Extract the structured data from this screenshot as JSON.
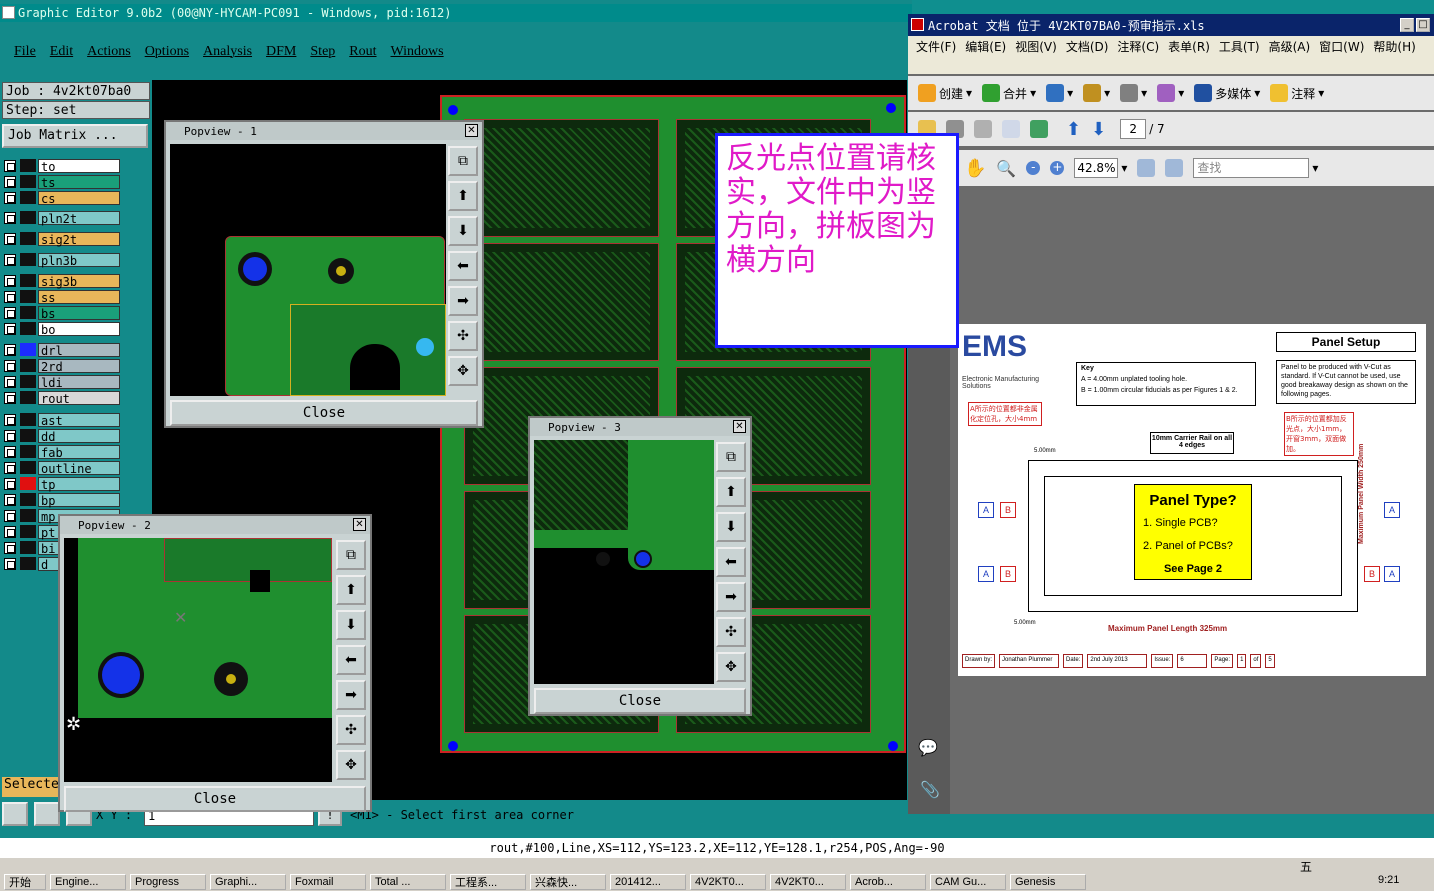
{
  "main": {
    "title": "Graphic Editor 9.0b2 (00@NY-HYCAM-PC091 - Windows, pid:1612)",
    "menu": [
      "File",
      "Edit",
      "Actions",
      "Options",
      "Analysis",
      "DFM",
      "Step",
      "Rout",
      "Windows"
    ],
    "job": "Job : 4v2kt07ba0",
    "step": "Step: set",
    "job_matrix": "Job Matrix ...",
    "layers": [
      {
        "name": "to",
        "color": "#ffffff",
        "swatch": "#111111"
      },
      {
        "name": "ts",
        "color": "#1aa07a",
        "swatch": "#111111"
      },
      {
        "name": "cs",
        "color": "#e8b65a",
        "swatch": "#111111"
      },
      {
        "name": "pln2t",
        "color": "#7fc8c8",
        "swatch": "#111111"
      },
      {
        "name": "sig2t",
        "color": "#e8b65a",
        "swatch": "#111111"
      },
      {
        "name": "pln3b",
        "color": "#7fc8c8",
        "swatch": "#111111"
      },
      {
        "name": "sig3b",
        "color": "#e8b65a",
        "swatch": "#111111"
      },
      {
        "name": "ss",
        "color": "#e8b65a",
        "swatch": "#111111"
      },
      {
        "name": "bs",
        "color": "#1aa07a",
        "swatch": "#111111"
      },
      {
        "name": "bo",
        "color": "#ffffff",
        "swatch": "#111111"
      },
      {
        "name": "drl",
        "color": "#a8b8c0",
        "swatch": "#1c2cff"
      },
      {
        "name": "2rd",
        "color": "#a8b8c0",
        "swatch": "#111111"
      },
      {
        "name": "ldi",
        "color": "#a8b8c0",
        "swatch": "#111111"
      },
      {
        "name": "rout",
        "color": "#d8d8d8",
        "swatch": "#111111"
      },
      {
        "name": "ast",
        "color": "#7fc8c8",
        "swatch": "#111111"
      },
      {
        "name": "dd",
        "color": "#7fc8c8",
        "swatch": "#111111"
      },
      {
        "name": "fab",
        "color": "#7fc8c8",
        "swatch": "#111111"
      },
      {
        "name": "outline",
        "color": "#7fc8c8",
        "swatch": "#111111"
      },
      {
        "name": "tp",
        "color": "#7fc8c8",
        "swatch": "#e01010"
      },
      {
        "name": "bp",
        "color": "#7fc8c8",
        "swatch": "#111111"
      },
      {
        "name": "mp",
        "color": "#7fc8c8",
        "swatch": "#111111"
      },
      {
        "name": "pt",
        "color": "#7fc8c8",
        "swatch": "#111111"
      },
      {
        "name": "bi",
        "color": "#7fc8c8",
        "swatch": "#111111"
      },
      {
        "name": "d",
        "color": "#7fc8c8",
        "swatch": "#111111"
      }
    ],
    "selected_label": "Selecte",
    "xy_label": "X Y :",
    "xy_value": "1",
    "prompt": "<M1> - Select first area corner",
    "info_line": "rout,#100,Line,XS=112,YS=123.2,XE=112,YE=128.1,r254,POS,Ang=-90"
  },
  "popviews": [
    {
      "title": "Popview - 1",
      "close": "Close"
    },
    {
      "title": "Popview - 2",
      "close": "Close"
    },
    {
      "title": "Popview - 3",
      "close": "Close"
    }
  ],
  "acrobat": {
    "title": "Acrobat 文档 位于 4V2KT07BA0-预审指示.xls",
    "menu": [
      "文件(F)",
      "编辑(E)",
      "视图(V)",
      "文档(D)",
      "注释(C)",
      "表单(R)",
      "工具(T)",
      "高级(A)",
      "窗口(W)",
      "帮助(H)"
    ],
    "toolbar1": [
      "创建",
      "合并",
      "多媒体",
      "注释"
    ],
    "page_current": "2",
    "page_total": "/ 7",
    "zoom": "42.8%",
    "search_placeholder": "查找",
    "doc": {
      "key_title": "Key",
      "key_a": "A = 4.00mm unplated tooling hole.",
      "key_b": "B = 1.00mm circular fiducials as per Figures 1 & 2.",
      "panel_setup": "Panel Setup",
      "panel_note": "Panel to be produced with V-Cut as standard. If V-Cut cannot be used, use good breakaway design as shown on the following pages.",
      "rail_note": "10mm Carrier Rail on all 4 edges",
      "panel_type_title": "Panel Type?",
      "panel_type_1": "1.  Single PCB?",
      "panel_type_2": "2.  Panel of PCBs?",
      "panel_type_3": "See Page 2",
      "max_len": "Maximum Panel Length 325mm",
      "max_width": "Maximum Panel Width 250mm",
      "drawn_by": "Drawn by:",
      "drawn_name": "Jonathan Plummer",
      "date_label": "Date:",
      "date_value": "2nd July 2013",
      "issue_label": "Issue:",
      "issue_value": "6",
      "page_label": "Page:",
      "page_value": "1",
      "page_of": "of",
      "page_total": "5",
      "ems_sub": "Electronic Manufacturing Solutions",
      "red_note_a": "A所示的位置都非金属化定位孔，大小4mm",
      "red_note_b": "B所示的位置都加反光点，大小1mm，开窗3mm，双面做加。",
      "dim_5": "5.00mm",
      "dim_5b": "5.00mm"
    }
  },
  "note": "反光点位置请核实，文件中为竖方向，拼板图为横方向",
  "taskbar": [
    "开始",
    "Engine...",
    "Progress",
    "Graphi...",
    "Foxmail",
    "Total ...",
    "工程系...",
    "兴森快...",
    "201412...",
    "4V2KT0...",
    "4V2KT0...",
    "Acrob...",
    "CAM Gu...",
    "Genesis"
  ],
  "clock": "9:21",
  "ime": "五"
}
